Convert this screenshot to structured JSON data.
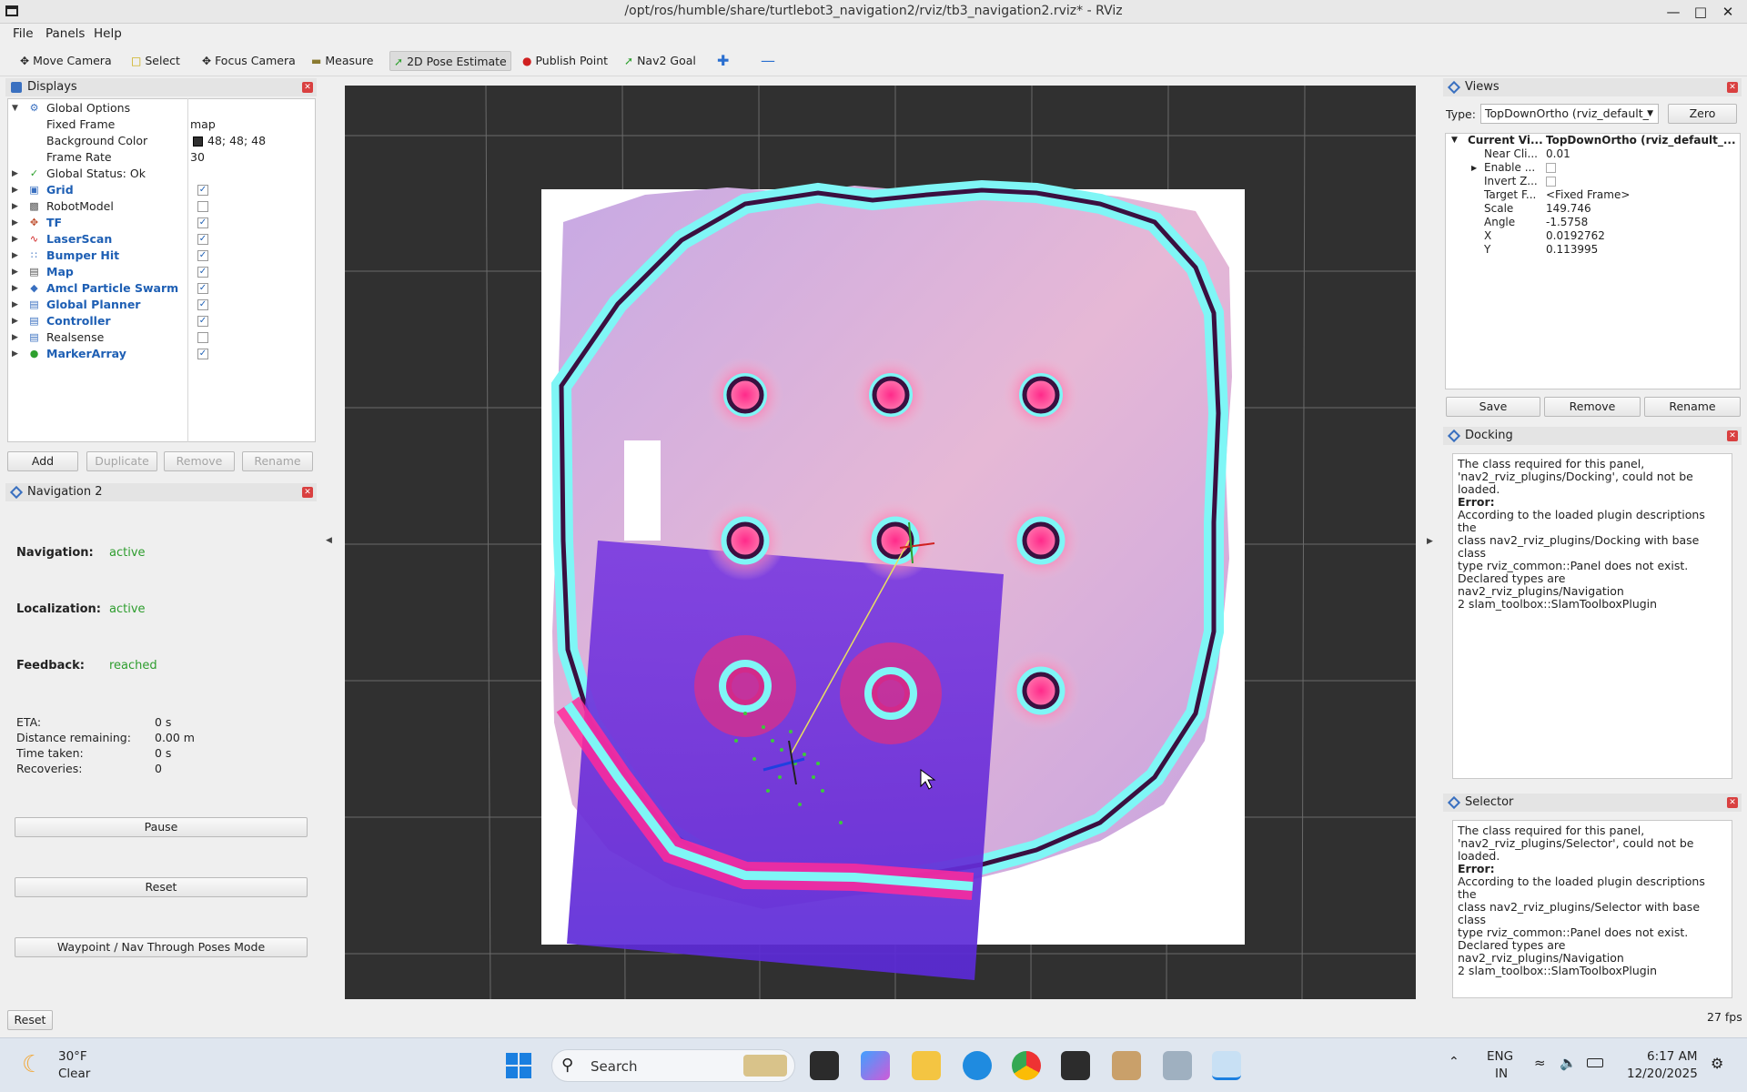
{
  "window": {
    "title": "/opt/ros/humble/share/turtlebot3_navigation2/rviz/tb3_navigation2.rviz* - RViz"
  },
  "menu": [
    "File",
    "Panels",
    "Help"
  ],
  "toolbar": {
    "move_camera": "Move Camera",
    "select": "Select",
    "focus_camera": "Focus Camera",
    "measure": "Measure",
    "pose_estimate": "2D Pose Estimate",
    "publish_point": "Publish Point",
    "nav2_goal": "Nav2 Goal"
  },
  "displays": {
    "title": "Displays",
    "global_options": "Global Options",
    "fixed_frame_key": "Fixed Frame",
    "fixed_frame_val": "map",
    "bg_color_key": "Background Color",
    "bg_color_val": "48; 48; 48",
    "bg_color_hex": "#303030",
    "frame_rate_key": "Frame Rate",
    "frame_rate_val": "30",
    "global_status": "Global Status: Ok",
    "items": [
      {
        "label": "Grid",
        "checked": true
      },
      {
        "label": "RobotModel",
        "checked": false
      },
      {
        "label": "TF",
        "checked": true
      },
      {
        "label": "LaserScan",
        "checked": true
      },
      {
        "label": "Bumper Hit",
        "checked": true
      },
      {
        "label": "Map",
        "checked": true
      },
      {
        "label": "Amcl Particle Swarm",
        "checked": true
      },
      {
        "label": "Global Planner",
        "checked": true
      },
      {
        "label": "Controller",
        "checked": true
      },
      {
        "label": "Realsense",
        "checked": false
      },
      {
        "label": "MarkerArray",
        "checked": true
      }
    ],
    "buttons": {
      "add": "Add",
      "duplicate": "Duplicate",
      "remove": "Remove",
      "rename": "Rename"
    }
  },
  "nav2": {
    "title": "Navigation 2",
    "navigation_lbl": "Navigation:",
    "navigation_val": "active",
    "localization_lbl": "Localization:",
    "localization_val": "active",
    "feedback_lbl": "Feedback:",
    "feedback_val": "reached",
    "eta_lbl": "ETA:",
    "eta_val": "0 s",
    "dist_lbl": "Distance remaining:",
    "dist_val": "0.00 m",
    "time_lbl": "Time taken:",
    "time_val": "0 s",
    "rec_lbl": "Recoveries:",
    "rec_val": "0",
    "pause": "Pause",
    "reset": "Reset",
    "waypoint": "Waypoint / Nav Through Poses Mode"
  },
  "views": {
    "title": "Views",
    "type_lbl": "Type:",
    "type_val": "TopDownOrtho (rviz_default_",
    "zero": "Zero",
    "current_key": "Current Vi...",
    "current_val": "TopDownOrtho (rviz_default_...",
    "props": [
      {
        "k": "Near Cli...",
        "v": "0.01"
      },
      {
        "k": "Enable ...",
        "v": ""
      },
      {
        "k": "Invert Z...",
        "v": ""
      },
      {
        "k": "Target F...",
        "v": "<Fixed Frame>"
      },
      {
        "k": "Scale",
        "v": "149.746"
      },
      {
        "k": "Angle",
        "v": "-1.5758"
      },
      {
        "k": "X",
        "v": "0.0192762"
      },
      {
        "k": "Y",
        "v": "0.113995"
      }
    ],
    "save": "Save",
    "remove": "Remove",
    "rename": "Rename"
  },
  "docking": {
    "title": "Docking",
    "line1": "The class required for this panel,",
    "line2": "'nav2_rviz_plugins/Docking', could not be loaded.",
    "error": "Error:",
    "line3": "According to the loaded plugin descriptions the",
    "line4": "class nav2_rviz_plugins/Docking with base class",
    "line5": "type rviz_common::Panel does not exist.",
    "line6": "Declared types are nav2_rviz_plugins/Navigation",
    "line7": "2 slam_toolbox::SlamToolboxPlugin"
  },
  "selector": {
    "title": "Selector",
    "line1": "The class required for this panel,",
    "line2": "'nav2_rviz_plugins/Selector', could not be loaded.",
    "error": "Error:",
    "line3": "According to the loaded plugin descriptions the",
    "line4": "class nav2_rviz_plugins/Selector with base class",
    "line5": "type rviz_common::Panel does not exist.",
    "line6": "Declared types are nav2_rviz_plugins/Navigation",
    "line7": "2 slam_toolbox::SlamToolboxPlugin"
  },
  "statusbar": {
    "reset": "Reset",
    "fps": "27 fps"
  },
  "taskbar": {
    "weather_temp": "30°F",
    "weather_desc": "Clear",
    "search": "Search",
    "lang1": "ENG",
    "lang2": "IN",
    "time": "6:17 AM",
    "date": "12/20/2025"
  }
}
